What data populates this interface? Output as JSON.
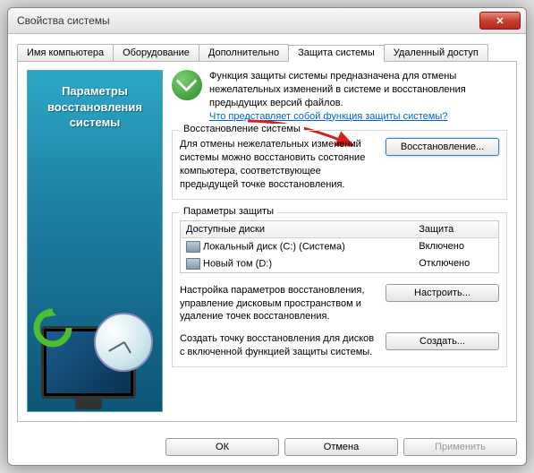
{
  "window": {
    "title": "Свойства системы"
  },
  "tabs": {
    "computer_name": "Имя компьютера",
    "hardware": "Оборудование",
    "advanced": "Дополнительно",
    "system_protection": "Защита системы",
    "remote": "Удаленный доступ"
  },
  "sidebar": {
    "title": "Параметры восстановления системы"
  },
  "intro": {
    "text": "Функция защиты системы предназначена для отмены нежелательных изменений в системе и восстановления предыдущих версий файлов.",
    "link": "Что представляет собой функция защиты системы?"
  },
  "restore": {
    "legend": "Восстановление системы",
    "desc": "Для отмены нежелательных изменений системы можно восстановить состояние компьютера, соответствующее предыдущей точке восстановления.",
    "button": "Восстановление..."
  },
  "protection": {
    "legend": "Параметры защиты",
    "col_drives": "Доступные диски",
    "col_protection": "Защита",
    "drives": [
      {
        "name": "Локальный диск (C:) (Система)",
        "status": "Включено"
      },
      {
        "name": "Новый том (D:)",
        "status": "Отключено"
      }
    ],
    "configure_desc": "Настройка параметров восстановления, управление дисковым пространством и удаление точек восстановления.",
    "configure_btn": "Настроить...",
    "create_desc": "Создать точку восстановления для дисков с включенной функцией защиты системы.",
    "create_btn": "Создать..."
  },
  "footer": {
    "ok": "ОК",
    "cancel": "Отмена",
    "apply": "Применить"
  }
}
